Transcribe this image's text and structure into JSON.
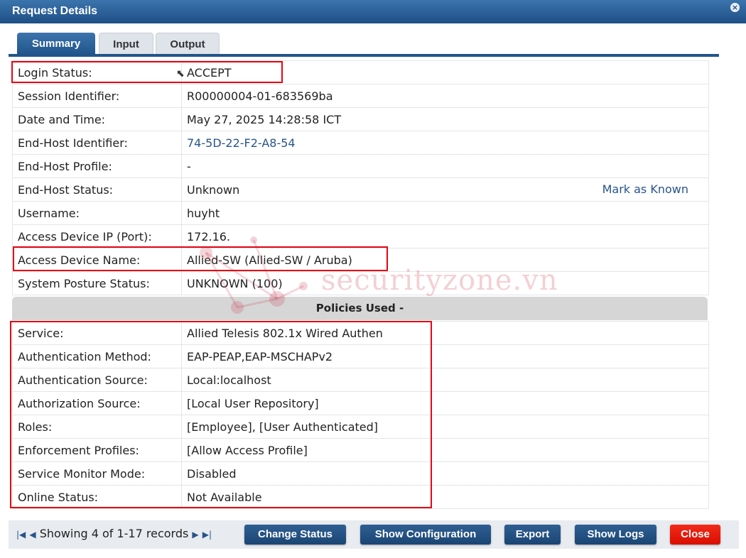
{
  "window": {
    "title": "Request Details"
  },
  "tabs": [
    {
      "label": "Summary",
      "active": true
    },
    {
      "label": "Input",
      "active": false
    },
    {
      "label": "Output",
      "active": false
    }
  ],
  "summary_rows": [
    {
      "label": "Login Status:",
      "value": "ACCEPT"
    },
    {
      "label": "Session Identifier:",
      "value": "R00000004-01-683569ba"
    },
    {
      "label": "Date and Time:",
      "value": "May 27, 2025 14:28:58 ICT"
    },
    {
      "label": "End-Host Identifier:",
      "value": "74-5D-22-F2-A8-54"
    },
    {
      "label": "End-Host Profile:",
      "value": "-"
    },
    {
      "label": "End-Host Status:",
      "value": "Unknown",
      "action": "Mark as Known"
    },
    {
      "label": "Username:",
      "value": "huyht"
    },
    {
      "label": "Access Device IP (Port):",
      "value": "172.16."
    },
    {
      "label": "Access Device Name:",
      "value": "Allied-SW (Allied-SW / Aruba)"
    },
    {
      "label": "System Posture Status:",
      "value": "UNKNOWN (100)"
    }
  ],
  "policies": {
    "header": "Policies Used -",
    "rows": [
      {
        "label": "Service:",
        "value": "Allied Telesis 802.1x Wired Authen"
      },
      {
        "label": "Authentication Method:",
        "value": "EAP-PEAP,EAP-MSCHAPv2"
      },
      {
        "label": "Authentication Source:",
        "value": "Local:localhost"
      },
      {
        "label": "Authorization Source:",
        "value": "[Local User Repository]"
      },
      {
        "label": "Roles:",
        "value": "[Employee], [User Authenticated]"
      },
      {
        "label": "Enforcement Profiles:",
        "value": "[Allow Access Profile]"
      },
      {
        "label": "Service Monitor Mode:",
        "value": "Disabled"
      },
      {
        "label": "Online Status:",
        "value": "Not Available"
      }
    ]
  },
  "watermark": "securityzone.vn",
  "footer": {
    "pager_text": "Showing 4 of 1-17 records",
    "buttons": {
      "change_status": "Change Status",
      "show_configuration": "Show Configuration",
      "export": "Export",
      "show_logs": "Show Logs",
      "close": "Close"
    }
  },
  "colors": {
    "titlebar": "#1d4f85",
    "link": "#27548c",
    "highlight_box": "#e30613",
    "close_button": "#e31205"
  }
}
